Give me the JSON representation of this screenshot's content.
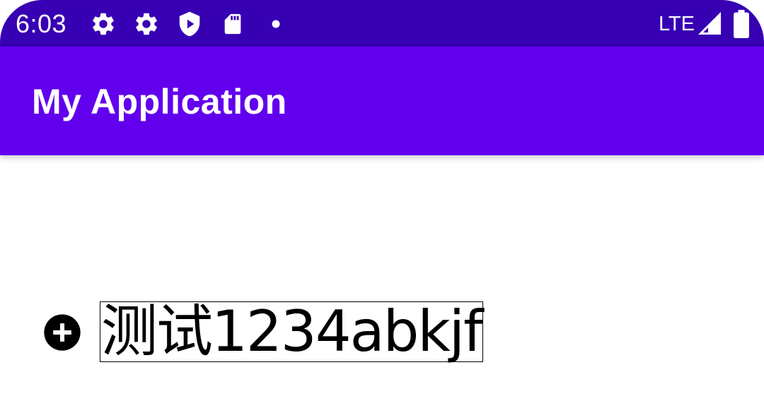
{
  "status_bar": {
    "time": "6:03",
    "left_icons": [
      "settings-gear-icon",
      "settings-gear-icon",
      "play-protect-shield-icon",
      "sd-card-icon",
      "notification-dot-icon"
    ],
    "network_label": "LTE",
    "right_icons": [
      "signal-strength-icon",
      "battery-icon"
    ],
    "background_color": "#3700b3"
  },
  "app_bar": {
    "title": "My Application",
    "background_color": "#6200ee"
  },
  "content": {
    "add_icon": "add-circle-icon",
    "text_value": "测试1234abkjf"
  }
}
